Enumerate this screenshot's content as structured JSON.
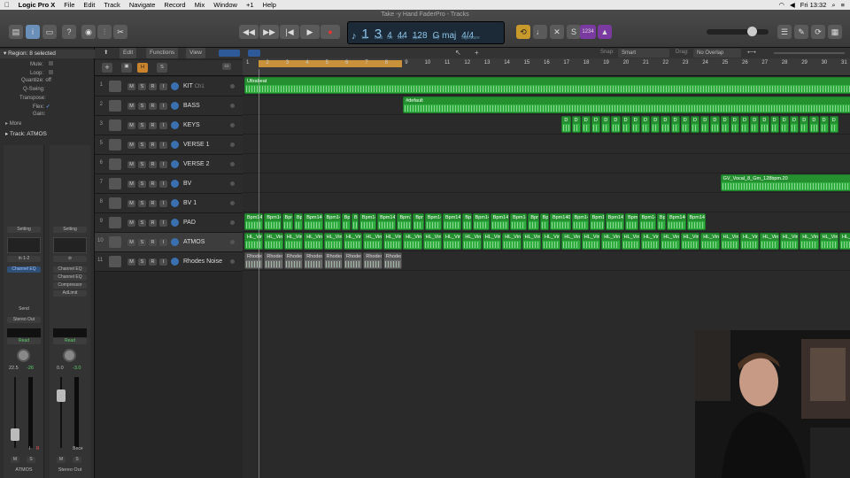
{
  "menubar": {
    "apple": "",
    "app": "Logic Pro X",
    "items": [
      "File",
      "Edit",
      "Track",
      "Navigate",
      "Record",
      "Mix",
      "Window",
      "+1",
      "Help"
    ],
    "clock": "Fri 13:32"
  },
  "window": {
    "title": "Take -y Hand FaderPro - Tracks"
  },
  "lcd": {
    "bar": "1",
    "beat": "3",
    "div": "4",
    "tick": "44",
    "tempo": "128",
    "key": "G maj",
    "sig": "4/4",
    "labels": {
      "bar": "bar",
      "beat": "beat",
      "div": "div",
      "tick": "tick",
      "tempo": "bpm",
      "key": "key",
      "sig": "signature"
    }
  },
  "toolbar": {
    "count_in": "1234"
  },
  "edit_bar": {
    "edit": "Edit",
    "functions": "Functions",
    "view": "View",
    "snap_label": "Snap:",
    "snap_value": "Smart",
    "drag_label": "Drag:",
    "drag_value": "No Overlap"
  },
  "inspector": {
    "region_header": "Region: 8 selected",
    "params": [
      {
        "label": "Mute:",
        "value": ""
      },
      {
        "label": "Loop:",
        "value": ""
      },
      {
        "label": "Quantize:",
        "value": "off"
      },
      {
        "label": "Q-Swing:",
        "value": ""
      },
      {
        "label": "Transpose:",
        "value": ""
      },
      {
        "label": "Flex:",
        "value": "✓"
      },
      {
        "label": "Gain:",
        "value": ""
      }
    ],
    "more": "More",
    "track_header": "Track: ATMOS",
    "strip1": {
      "setting": "Setting",
      "input": "in 1-2",
      "eq": "Channel EQ",
      "send": "Send",
      "output": "Stereo Out",
      "automation": "Read",
      "pan": "22.5",
      "vol": "-26",
      "name": "ATMOS",
      "m": "M",
      "s": "S",
      "i": "I",
      "r": "R"
    },
    "strip2": {
      "setting": "Setting",
      "plugins": [
        "Channel EQ",
        "Channel EQ",
        "Compressor",
        "AdLimit"
      ],
      "automation": "Read",
      "pan": "0.0",
      "vol": "-3.0",
      "name": "Stereo Out",
      "bnce": "Bnce",
      "m": "M",
      "s": "S"
    }
  },
  "tracks": [
    {
      "num": "1",
      "name": "KIT",
      "sub": "Ch1"
    },
    {
      "num": "2",
      "name": "BASS",
      "sub": ""
    },
    {
      "num": "3",
      "name": "KEYS",
      "sub": ""
    },
    {
      "num": "5",
      "name": "VERSE 1",
      "sub": ""
    },
    {
      "num": "6",
      "name": "VERSE 2",
      "sub": ""
    },
    {
      "num": "7",
      "name": "BV",
      "sub": ""
    },
    {
      "num": "8",
      "name": "BV 1",
      "sub": ""
    },
    {
      "num": "9",
      "name": "PAD",
      "sub": ""
    },
    {
      "num": "10",
      "name": "ATMOS",
      "sub": ""
    },
    {
      "num": "11",
      "name": "Rhodes Noise",
      "sub": ""
    }
  ],
  "track_buttons": {
    "m": "M",
    "s": "S",
    "r": "R",
    "i": "I"
  },
  "ruler": [
    "1",
    "2",
    "3",
    "4",
    "5",
    "6",
    "7",
    "8",
    "9",
    "10",
    "11",
    "12",
    "13",
    "14",
    "15",
    "16",
    "17",
    "18",
    "19",
    "20",
    "21",
    "22",
    "23",
    "24",
    "25",
    "26",
    "27",
    "28",
    "29",
    "30",
    "31"
  ],
  "regions": {
    "kit": "Ultrabeat",
    "bass": "#default",
    "keys_label": "D",
    "bv": "GV_Vocal_8_Gm_128bpm.20",
    "pad_label": "Bpm140_G_High",
    "pad_short": "Bpm14",
    "pad_tiny": "Bp",
    "atmos_label": "HL_Vin",
    "rhodes_label": "Rhodes"
  },
  "colors": {
    "region_green": "#2fae3f",
    "cycle": "#c8913a",
    "lcd_text": "#8fc7ee"
  }
}
